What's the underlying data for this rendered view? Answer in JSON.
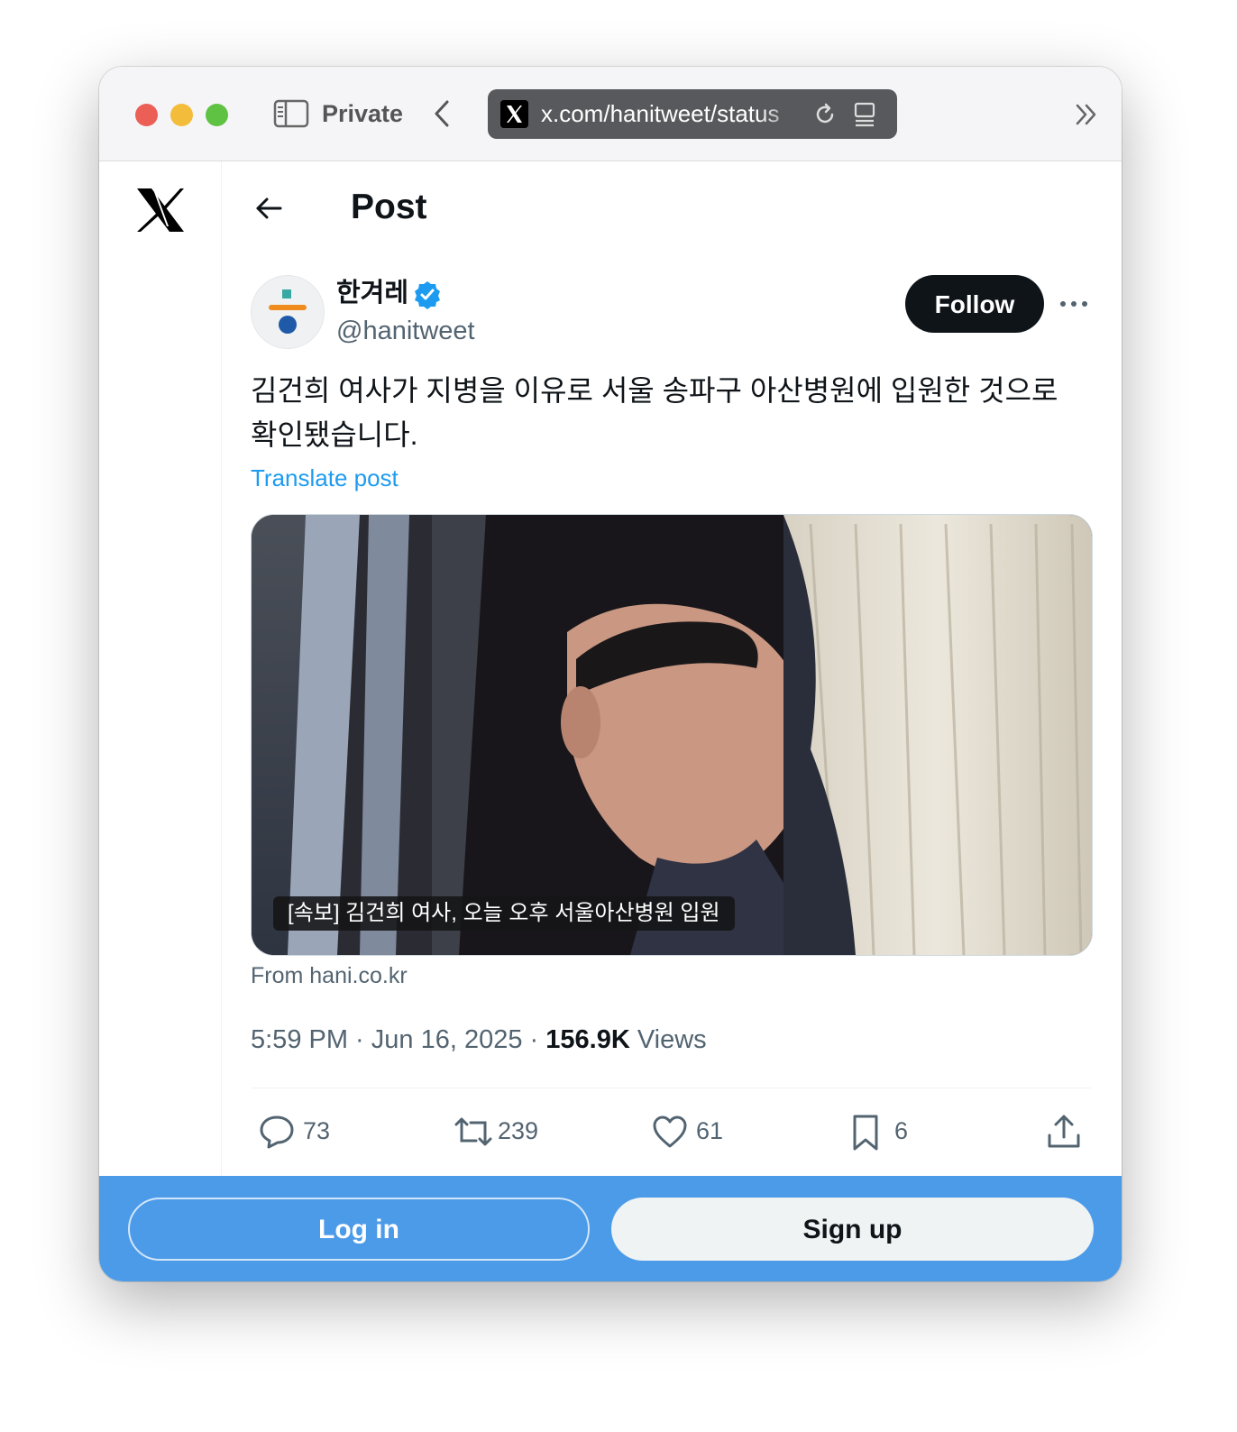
{
  "browser": {
    "mode_label": "Private",
    "url": "x.com/hanitweet/status"
  },
  "header": {
    "title": "Post"
  },
  "author": {
    "display_name": "한겨레",
    "handle": "@hanitweet",
    "verified": true,
    "follow_label": "Follow"
  },
  "post": {
    "text": "김건희 여사가 지병을 이유로 서울 송파구 아산병원에 입원한 것으로 확인됐습니다.",
    "translate_label": "Translate post",
    "media_caption": "[속보] 김건희 여사, 오늘 오후 서울아산병원 입원",
    "media_source": "From hani.co.kr",
    "timestamp": "5:59 PM · Jun 16, 2025 · ",
    "views_count": "156.9K",
    "views_label": " Views"
  },
  "actions": {
    "replies": "73",
    "reposts": "239",
    "likes": "61",
    "bookmarks": "6"
  },
  "footer": {
    "login_label": "Log in",
    "signup_label": "Sign up"
  },
  "colors": {
    "accent_blue": "#1d9bf0",
    "bottom_bar": "#4c9be8",
    "follow_button": "#0f1419"
  },
  "icons": [
    "sidebar-icon",
    "back-chevron-icon",
    "x-favicon-icon",
    "reload-icon",
    "reader-icon",
    "overflow-chevron-icon",
    "x-logo-icon",
    "back-arrow-icon",
    "verified-badge-icon",
    "more-icon",
    "reply-icon",
    "repost-icon",
    "like-icon",
    "bookmark-icon",
    "share-icon"
  ]
}
